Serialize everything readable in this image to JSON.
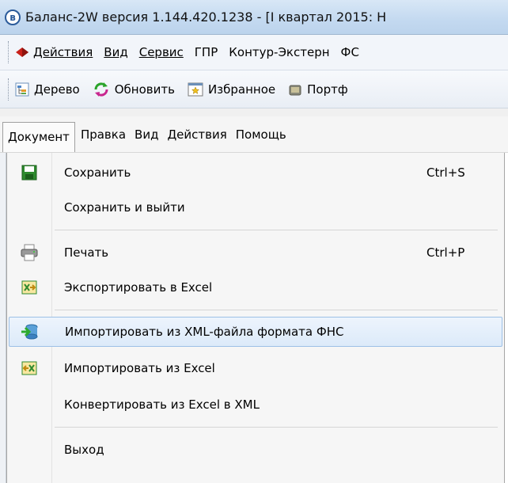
{
  "window": {
    "app_icon": "в",
    "title": "Баланс-2W  версия 1.144.420.1238 - [I квартал 2015: Н"
  },
  "main_menu": {
    "items": [
      {
        "label": "Действия",
        "icon": "book-icon"
      },
      {
        "label": "Вид"
      },
      {
        "label": "Сервис"
      },
      {
        "label": "ГПР"
      },
      {
        "label": "Контур-Экстерн"
      },
      {
        "label": "ФС"
      }
    ]
  },
  "toolbar": {
    "items": [
      {
        "label": "Дерево",
        "icon": "tree-icon"
      },
      {
        "label": "Обновить",
        "icon": "refresh-icon"
      },
      {
        "label": "Избранное",
        "icon": "favorites-icon"
      },
      {
        "label": "Портф",
        "icon": "portfolio-icon"
      }
    ]
  },
  "doc_menu": {
    "items": [
      {
        "label": "Документ",
        "active": true
      },
      {
        "label": "Правка"
      },
      {
        "label": "Вид"
      },
      {
        "label": "Действия"
      },
      {
        "label": "Помощь"
      }
    ]
  },
  "dropdown": {
    "items": [
      {
        "label": "Сохранить",
        "shortcut": "Ctrl+S",
        "icon": "save-icon"
      },
      {
        "label": "Сохранить и выйти",
        "shortcut": "",
        "icon": ""
      },
      {
        "label": "Печать",
        "shortcut": "Ctrl+P",
        "icon": "printer-icon"
      },
      {
        "label": "Экспортировать в Excel",
        "shortcut": "",
        "icon": "export-excel-icon"
      },
      {
        "label": "Импортировать из XML-файла формата ФНС",
        "shortcut": "",
        "icon": "import-xml-icon",
        "highlighted": true
      },
      {
        "label": "Импортировать из Excel",
        "shortcut": "",
        "icon": "import-excel-icon"
      },
      {
        "label": "Конвертировать из Excel в XML",
        "shortcut": "",
        "icon": ""
      },
      {
        "label": "Выход",
        "shortcut": "",
        "icon": ""
      }
    ]
  },
  "colors": {
    "highlight_border": "#9dc0e6",
    "titlebar": "#c3d9f0",
    "save_green": "#2e8b2e"
  }
}
